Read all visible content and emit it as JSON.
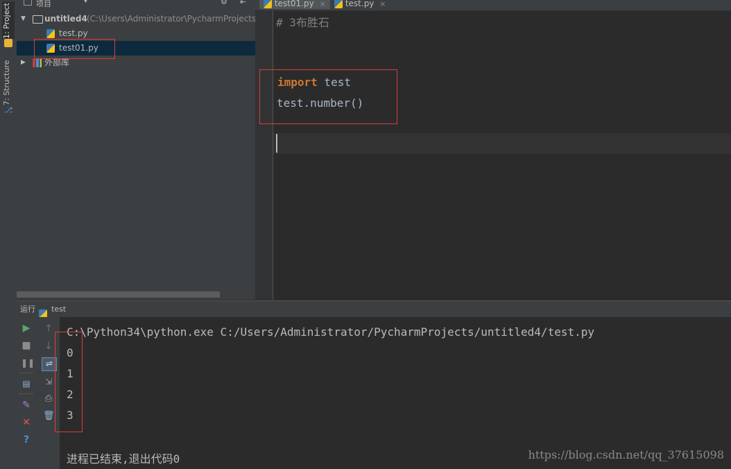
{
  "tool_strip": {
    "project_tab": "1: Project",
    "structure_tab": "7: Structure"
  },
  "project_panel": {
    "header_label": "项目",
    "root_name": "untitled4",
    "root_path": "(C:\\Users\\Administrator\\PycharmProjects\\",
    "files": [
      "test.py",
      "test01.py"
    ],
    "selected_file": "test01.py",
    "external_libs": "外部库"
  },
  "editor": {
    "tabs": [
      {
        "label": "test01.py",
        "active": true
      },
      {
        "label": "test.py",
        "active": false
      }
    ],
    "tab_close_glyph": "×",
    "comment_line": "# 3布胜石",
    "import_keyword": "import",
    "import_module": " test",
    "call_line": "test.number()"
  },
  "run_panel": {
    "label": "运行",
    "config_name": "test",
    "command_line": "C:\\Python34\\python.exe C:/Users/Administrator/PycharmProjects/untitled4/test.py",
    "output": [
      "0",
      "1",
      "2",
      "3"
    ],
    "exit_message": "进程已结束,退出代码0"
  },
  "watermark": "https://blog.csdn.net/qq_37615098",
  "colors": {
    "keyword": "#cc7832",
    "comment": "#808080",
    "highlight_box": "#e23b3b",
    "run_green": "#59a869",
    "stop_red": "#e05555"
  }
}
